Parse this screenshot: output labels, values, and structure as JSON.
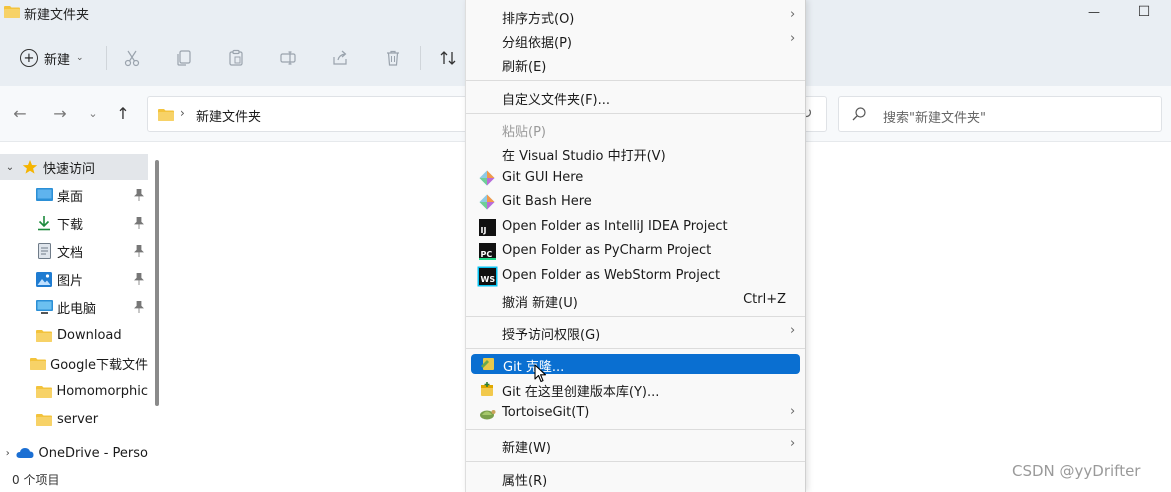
{
  "window": {
    "title": "新建文件夹",
    "minimize_glyph": "—",
    "maximize_glyph": "☐"
  },
  "toolbar": {
    "new_label": "新建",
    "icons": [
      "cut-icon",
      "copy-icon",
      "paste-icon",
      "rename-icon",
      "share-icon",
      "delete-icon",
      "sort-icon"
    ]
  },
  "address": {
    "path_label": "新建文件夹",
    "search_placeholder": "搜索\"新建文件夹\""
  },
  "sidebar": {
    "items": [
      {
        "label": "快速访问",
        "icon": "star-icon",
        "expandable": true,
        "pinned": false
      },
      {
        "label": "桌面",
        "icon": "desktop-icon",
        "pinned": true
      },
      {
        "label": "下载",
        "icon": "download-icon",
        "pinned": true
      },
      {
        "label": "文档",
        "icon": "document-icon",
        "pinned": true
      },
      {
        "label": "图片",
        "icon": "picture-icon",
        "pinned": true
      },
      {
        "label": "此电脑",
        "icon": "computer-icon",
        "pinned": true
      },
      {
        "label": "Download",
        "icon": "folder-icon",
        "pinned": false
      },
      {
        "label": "Google下载文件",
        "icon": "folder-icon",
        "pinned": false
      },
      {
        "label": "Homomorphic",
        "icon": "folder-icon",
        "pinned": false
      },
      {
        "label": "server",
        "icon": "folder-icon",
        "pinned": false
      },
      {
        "label": "OneDrive - Perso",
        "icon": "onedrive-icon",
        "expandable": true,
        "pinned": false
      }
    ]
  },
  "status": {
    "item_count": "0 个项目"
  },
  "watermark": "CSDN @yyDrifter",
  "context_menu": {
    "items": [
      {
        "label": "排序方式(O)",
        "submenu": true
      },
      {
        "label": "分组依据(P)",
        "submenu": true
      },
      {
        "label": "刷新(E)"
      },
      {
        "label": "自定义文件夹(F)..."
      },
      {
        "label": "粘贴(P)",
        "disabled": true
      },
      {
        "label": "在 Visual Studio 中打开(V)"
      },
      {
        "label": "Git GUI Here",
        "icon": "git-gui-icon"
      },
      {
        "label": "Git Bash Here",
        "icon": "git-bash-icon"
      },
      {
        "label": "Open Folder as IntelliJ IDEA Project",
        "icon": "intellij-icon",
        "badge": "IJ"
      },
      {
        "label": "Open Folder as PyCharm Project",
        "icon": "pycharm-icon",
        "badge": "PC"
      },
      {
        "label": "Open Folder as WebStorm Project",
        "icon": "webstorm-icon",
        "badge": "WS"
      },
      {
        "label": "撤消 新建(U)",
        "shortcut": "Ctrl+Z"
      },
      {
        "label": "授予访问权限(G)",
        "submenu": true
      },
      {
        "label": "Git 克隆...",
        "icon": "tortoise-clone-icon",
        "highlighted": true
      },
      {
        "label": "Git 在这里创建版本库(Y)...",
        "icon": "tortoise-repo-icon"
      },
      {
        "label": "TortoiseGit(T)",
        "icon": "tortoisegit-icon",
        "submenu": true
      },
      {
        "label": "新建(W)",
        "submenu": true
      },
      {
        "label": "属性(R)"
      }
    ]
  },
  "colors": {
    "highlight": "#0a6fd1",
    "toolbar_bg": "#e9eef3",
    "folder": "#f3c33c",
    "star": "#f5b400",
    "intellij": "#111111",
    "pycharm_accent": "#21d789",
    "webstorm_accent": "#07c3f2"
  }
}
